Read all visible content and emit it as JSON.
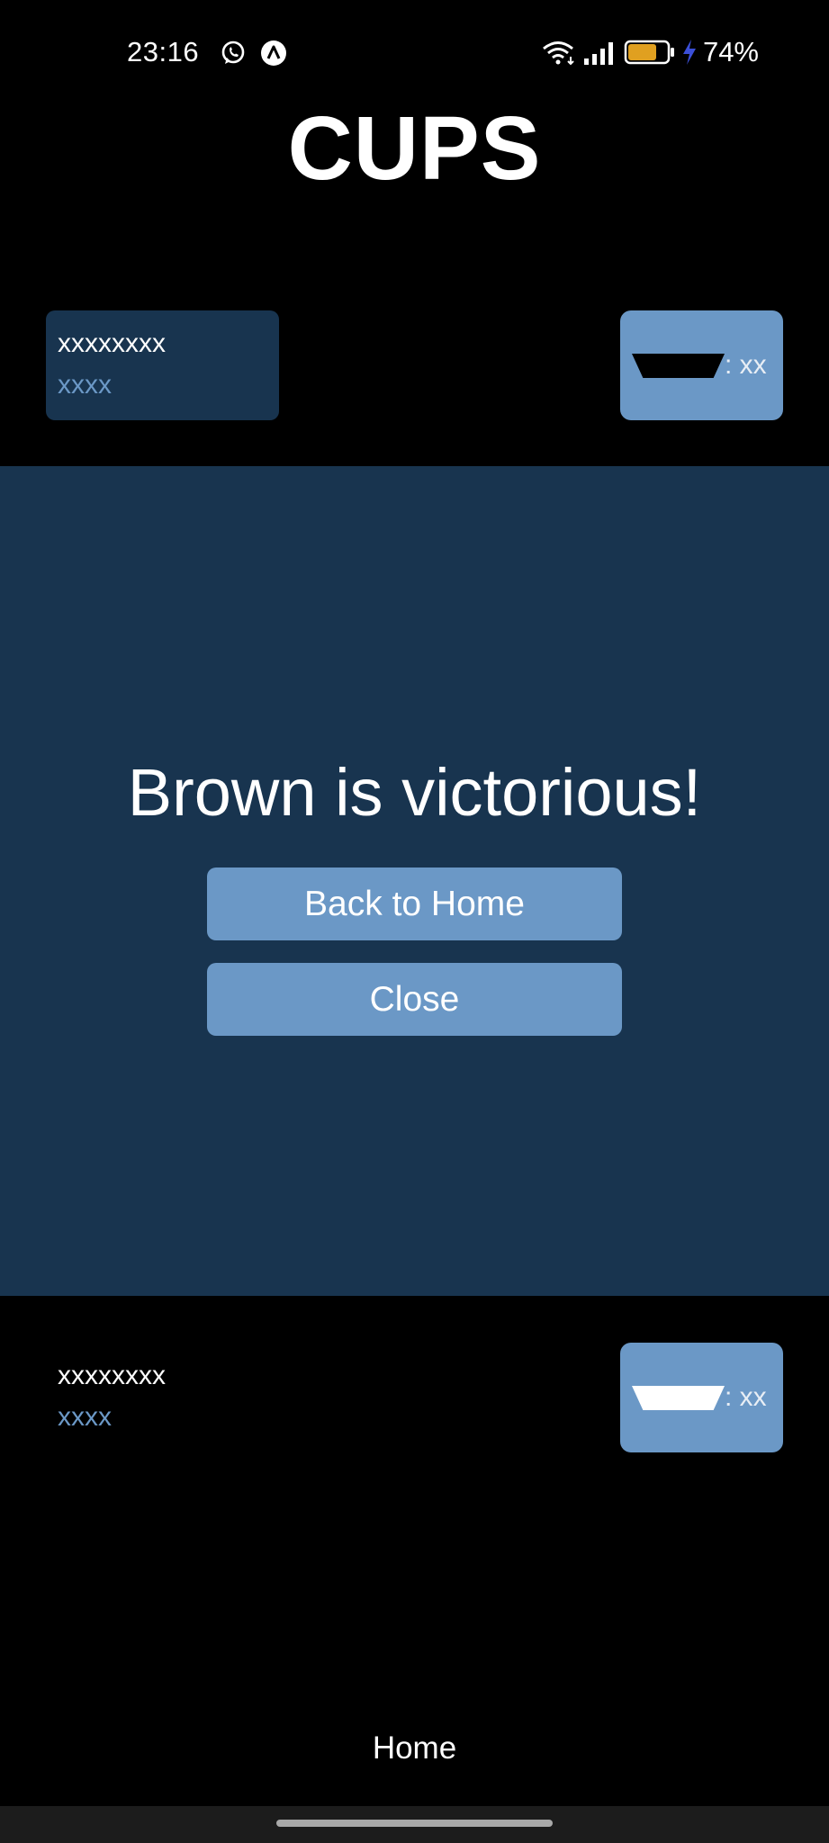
{
  "status_bar": {
    "time": "23:16",
    "battery_percent": "74%",
    "battery_level": 0.74,
    "icons": [
      "whatsapp-icon",
      "app-notification-icon",
      "wifi-icon",
      "signal-icon",
      "battery-icon",
      "charging-icon"
    ]
  },
  "app": {
    "title": "CUPS"
  },
  "opponent": {
    "name": "xxxxxxxx",
    "subtitle": "xxxx",
    "cups_label": ": xx",
    "cup_color": "#000000"
  },
  "player": {
    "name": "xxxxxxxx",
    "subtitle": "xxxx",
    "cups_label": ": xx",
    "cup_color": "#ffffff"
  },
  "overlay": {
    "message": "Brown is victorious!",
    "back_home_label": "Back to Home",
    "close_label": "Close"
  },
  "bottom_nav": {
    "home_label": "Home"
  },
  "colors": {
    "background": "#000000",
    "panel": "#18344f",
    "accent": "#6b98c6",
    "battery_fill": "#e0a020",
    "charging": "#3b4fd8"
  }
}
